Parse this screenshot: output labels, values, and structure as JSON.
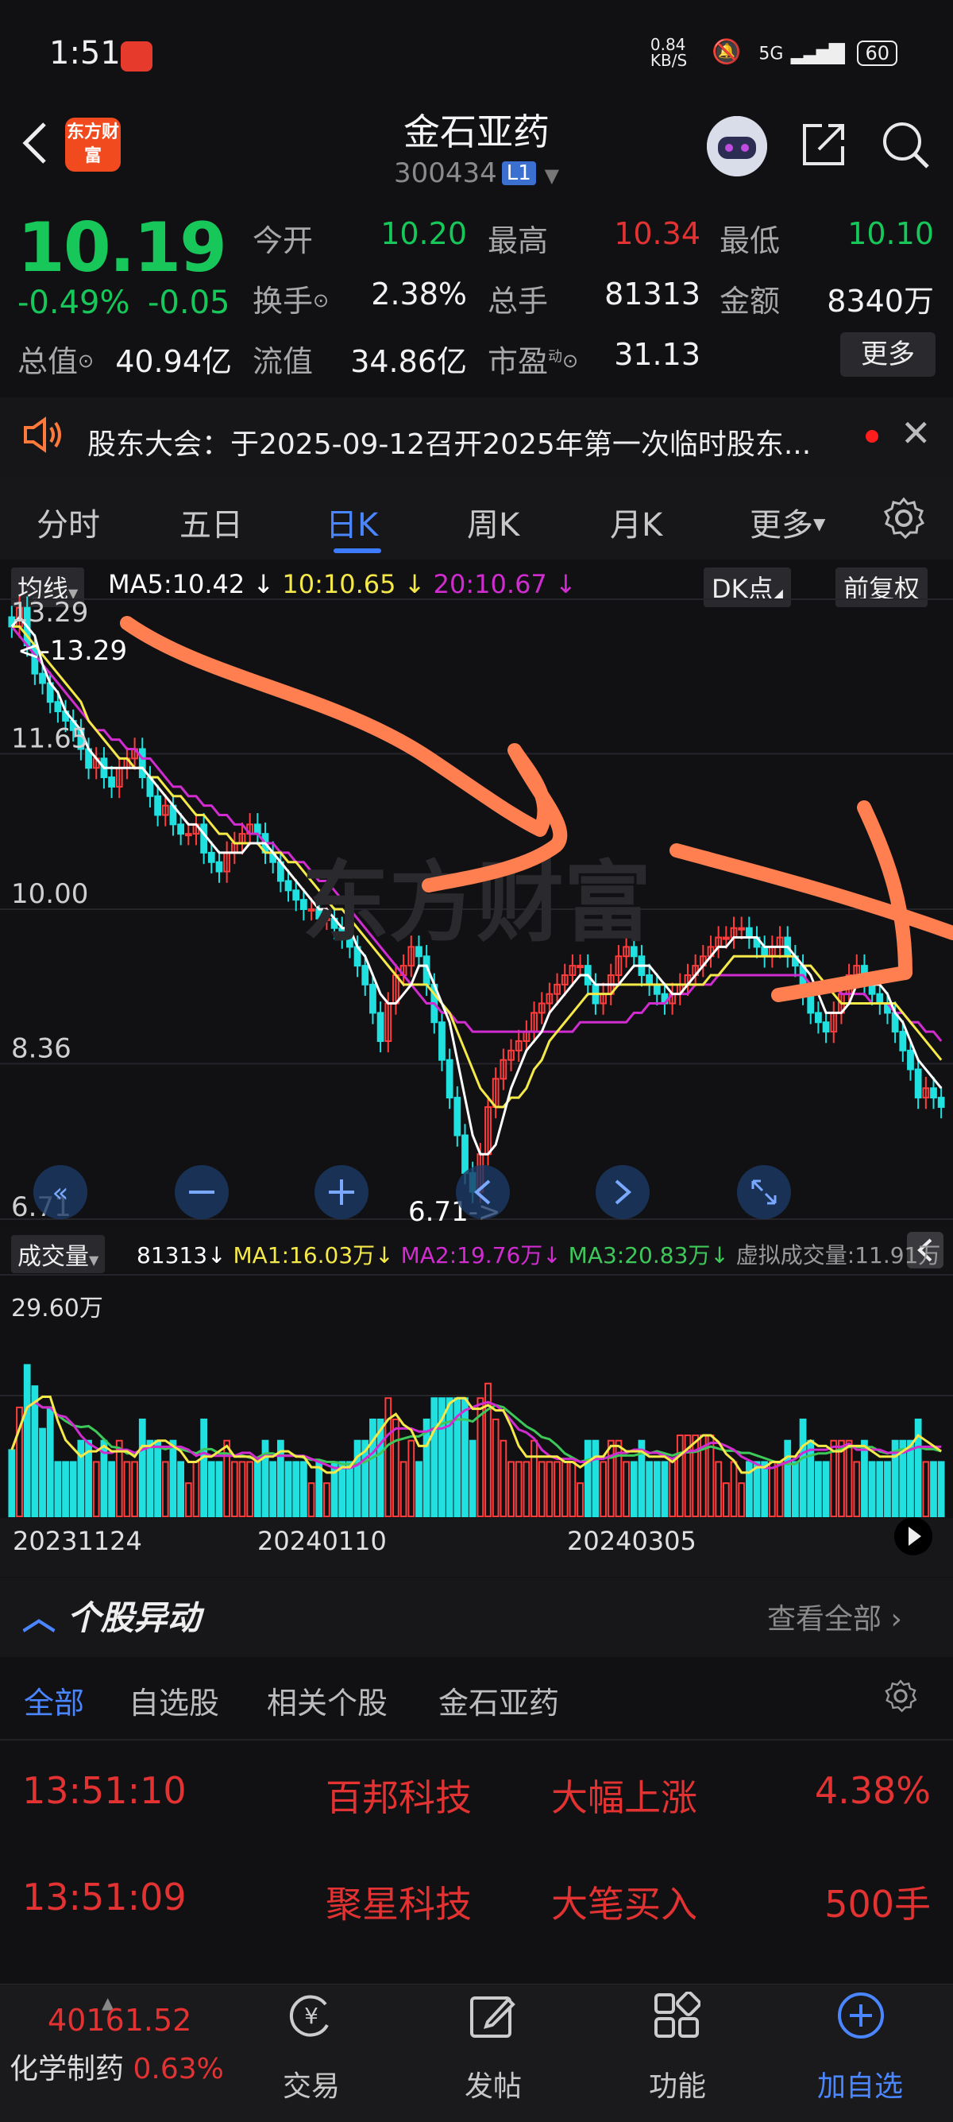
{
  "status_bar": {
    "time": "1:51",
    "net_speed": "0.84 KB/S",
    "network": "5G",
    "battery": "60"
  },
  "header": {
    "back_icon": "chevron-left-icon",
    "logo_text": "东方财富",
    "stock_name": "金石亚药",
    "stock_code": "300434",
    "level_badge": "L1",
    "share_icon": "share-icon",
    "search_icon": "search-icon"
  },
  "quote": {
    "price": "10.19",
    "change_pct": "-0.49%",
    "change_amt": "-0.05",
    "fields": [
      {
        "label": "今开",
        "value": "10.20",
        "color": "#17c75a"
      },
      {
        "label": "最高",
        "value": "10.34",
        "color": "#e23232"
      },
      {
        "label": "最低",
        "value": "10.10",
        "color": "#17c75a"
      },
      {
        "label": "换手",
        "value": "2.38%",
        "color": "#f2f2f2"
      },
      {
        "label": "总手",
        "value": "81313",
        "color": "#f2f2f2"
      },
      {
        "label": "金额",
        "value": "8340万",
        "color": "#f2f2f2"
      },
      {
        "label": "总值",
        "value": "40.94亿",
        "color": "#f2f2f2"
      },
      {
        "label": "流值",
        "value": "34.86亿",
        "color": "#f2f2f2"
      },
      {
        "label": "市盈",
        "value": "31.13",
        "color": "#f2f2f2"
      }
    ],
    "pe_superscript": "动",
    "more_label": "更多"
  },
  "notice": {
    "text": "股东大会：于2025-09-12召开2025年第一次临时股东..."
  },
  "tabs": [
    "分时",
    "五日",
    "日K",
    "周K",
    "月K",
    "更多"
  ],
  "active_tab": "日K",
  "chart_legend": {
    "ma_dropdown": "均线",
    "ma5": "MA5:10.42",
    "ma10": "10:10.65",
    "ma20": "20:10.67",
    "dk_button": "DK点",
    "adjust_button": "前复权",
    "ma5_color": "#ffffff",
    "ma10_color": "#f5e94a",
    "ma20_color": "#d02cd0"
  },
  "volume_legend": {
    "dropdown": "成交量",
    "volume": "81313",
    "ma1": "MA1:16.03万",
    "ma2": "MA2:19.76万",
    "ma3": "MA3:20.83万",
    "virtual": "虚拟成交量:11.91万",
    "ma1_color": "#f5e94a",
    "ma2_color": "#d02cd0",
    "ma3_color": "#3fc85a"
  },
  "chart_data": {
    "type": "candlestick",
    "y_tick_labels": [
      "13.29",
      "11.65",
      "10.00",
      "8.36",
      "6.71"
    ],
    "ylim": [
      6.71,
      13.29
    ],
    "max_label": "<-13.29",
    "min_label": "6.71->",
    "x_tick_labels": [
      "20231124",
      "20240110",
      "20240305"
    ],
    "volume_max_label": "29.60万",
    "close": [
      13.0,
      13.2,
      12.8,
      12.5,
      12.4,
      12.2,
      12.1,
      12.0,
      11.9,
      11.7,
      11.5,
      11.6,
      11.4,
      11.3,
      11.5,
      11.6,
      11.7,
      11.4,
      11.2,
      11.0,
      11.1,
      10.9,
      10.8,
      10.8,
      10.9,
      10.6,
      10.5,
      10.4,
      10.6,
      10.7,
      10.8,
      10.9,
      10.8,
      10.6,
      10.5,
      10.3,
      10.2,
      10.1,
      10.0,
      10.0,
      9.9,
      9.9,
      9.8,
      9.7,
      9.6,
      9.4,
      9.2,
      8.9,
      8.6,
      9.0,
      9.3,
      9.4,
      9.6,
      9.5,
      9.2,
      8.8,
      8.4,
      8.0,
      7.6,
      7.2,
      7.0,
      7.4,
      7.9,
      8.2,
      8.4,
      8.5,
      8.6,
      8.7,
      8.9,
      9.0,
      9.1,
      9.2,
      9.3,
      9.4,
      9.4,
      9.2,
      9.0,
      9.1,
      9.3,
      9.5,
      9.6,
      9.5,
      9.3,
      9.2,
      9.1,
      9.0,
      9.1,
      9.2,
      9.3,
      9.4,
      9.5,
      9.6,
      9.7,
      9.7,
      9.8,
      9.8,
      9.7,
      9.6,
      9.5,
      9.6,
      9.7,
      9.5,
      9.4,
      9.1,
      8.9,
      8.8,
      8.7,
      8.9,
      9.1,
      9.3,
      9.4,
      9.2,
      9.1,
      9.0,
      8.9,
      8.7,
      8.5,
      8.3,
      8.0,
      8.1,
      8.0,
      7.9
    ],
    "ma5": [
      13.0,
      13.1,
      13.0,
      12.9,
      12.6,
      12.4,
      12.3,
      12.1,
      12.0,
      11.9,
      11.7,
      11.6,
      11.5,
      11.5,
      11.5,
      11.5,
      11.5,
      11.5,
      11.4,
      11.3,
      11.2,
      11.1,
      11.0,
      10.9,
      10.9,
      10.8,
      10.7,
      10.6,
      10.6,
      10.6,
      10.6,
      10.7,
      10.7,
      10.7,
      10.6,
      10.5,
      10.4,
      10.3,
      10.2,
      10.1,
      10.0,
      10.0,
      9.9,
      9.8,
      9.8,
      9.6,
      9.5,
      9.3,
      9.1,
      9.0,
      9.0,
      9.1,
      9.2,
      9.4,
      9.4,
      9.2,
      9.0,
      8.8,
      8.4,
      8.0,
      7.6,
      7.4,
      7.4,
      7.5,
      7.8,
      8.1,
      8.3,
      8.5,
      8.6,
      8.7,
      8.9,
      9.0,
      9.1,
      9.2,
      9.3,
      9.3,
      9.2,
      9.2,
      9.2,
      9.2,
      9.3,
      9.4,
      9.4,
      9.4,
      9.3,
      9.2,
      9.1,
      9.1,
      9.2,
      9.3,
      9.4,
      9.5,
      9.6,
      9.6,
      9.7,
      9.7,
      9.7,
      9.7,
      9.6,
      9.6,
      9.6,
      9.6,
      9.5,
      9.4,
      9.3,
      9.1,
      8.9,
      8.9,
      8.9,
      9.0,
      9.2,
      9.2,
      9.2,
      9.2,
      9.1,
      8.9,
      8.8,
      8.6,
      8.4,
      8.3,
      8.2,
      8.1
    ],
    "ma10": [
      13.0,
      13.0,
      12.9,
      12.8,
      12.7,
      12.6,
      12.5,
      12.4,
      12.3,
      12.2,
      12.0,
      11.9,
      11.8,
      11.7,
      11.6,
      11.6,
      11.5,
      11.5,
      11.4,
      11.4,
      11.3,
      11.2,
      11.2,
      11.1,
      11.0,
      11.0,
      10.9,
      10.8,
      10.8,
      10.7,
      10.7,
      10.7,
      10.7,
      10.6,
      10.6,
      10.6,
      10.5,
      10.5,
      10.4,
      10.3,
      10.2,
      10.1,
      10.0,
      10.0,
      9.9,
      9.8,
      9.7,
      9.6,
      9.5,
      9.4,
      9.3,
      9.2,
      9.2,
      9.2,
      9.2,
      9.1,
      9.0,
      8.9,
      8.7,
      8.5,
      8.3,
      8.1,
      8.0,
      7.9,
      7.9,
      8.0,
      8.0,
      8.1,
      8.3,
      8.4,
      8.6,
      8.7,
      8.8,
      8.9,
      9.0,
      9.1,
      9.1,
      9.1,
      9.1,
      9.2,
      9.2,
      9.2,
      9.2,
      9.2,
      9.2,
      9.2,
      9.2,
      9.2,
      9.2,
      9.2,
      9.2,
      9.3,
      9.3,
      9.4,
      9.5,
      9.5,
      9.5,
      9.5,
      9.5,
      9.5,
      9.5,
      9.5,
      9.5,
      9.4,
      9.4,
      9.3,
      9.2,
      9.1,
      9.0,
      9.0,
      9.0,
      9.0,
      9.0,
      9.0,
      9.0,
      9.0,
      8.9,
      8.8,
      8.7,
      8.6,
      8.5,
      8.4
    ],
    "ma20": [
      13.0,
      12.9,
      12.8,
      12.7,
      12.6,
      12.5,
      12.4,
      12.3,
      12.2,
      12.1,
      12.0,
      11.9,
      11.9,
      11.8,
      11.8,
      11.7,
      11.7,
      11.6,
      11.6,
      11.5,
      11.4,
      11.3,
      11.3,
      11.2,
      11.2,
      11.1,
      11.1,
      11.0,
      11.0,
      10.9,
      10.9,
      10.8,
      10.8,
      10.7,
      10.7,
      10.6,
      10.6,
      10.5,
      10.5,
      10.4,
      10.3,
      10.3,
      10.2,
      10.1,
      10.0,
      9.9,
      9.8,
      9.7,
      9.6,
      9.5,
      9.4,
      9.3,
      9.2,
      9.1,
      9.0,
      9.0,
      8.9,
      8.9,
      8.8,
      8.8,
      8.7,
      8.7,
      8.7,
      8.7,
      8.7,
      8.7,
      8.7,
      8.7,
      8.7,
      8.7,
      8.7,
      8.7,
      8.7,
      8.7,
      8.8,
      8.8,
      8.8,
      8.8,
      8.8,
      8.8,
      8.8,
      8.9,
      8.9,
      9.0,
      9.0,
      9.0,
      9.1,
      9.1,
      9.1,
      9.2,
      9.2,
      9.2,
      9.3,
      9.3,
      9.3,
      9.3,
      9.3,
      9.3,
      9.3,
      9.3,
      9.3,
      9.3,
      9.3,
      9.3,
      9.2,
      9.2,
      9.2,
      9.2,
      9.1,
      9.1,
      9.1,
      9.1,
      9.0,
      9.0,
      9.0,
      8.9,
      8.9,
      8.8,
      8.8,
      8.7,
      8.7,
      8.6
    ]
  },
  "section": {
    "title": "个股异动",
    "view_all": "查看全部",
    "subtabs": [
      "全部",
      "自选股",
      "相关个股",
      "金石亚药"
    ],
    "rows": [
      {
        "time": "13:51:10",
        "name": "百邦科技",
        "event": "大幅上涨",
        "value": "4.38%"
      },
      {
        "time": "13:51:09",
        "name": "聚星科技",
        "event": "大笔买入",
        "value": "500手"
      }
    ]
  },
  "bottom_nav": {
    "index_value": "40161.52",
    "index_name": "化学制药",
    "index_change": "0.63%",
    "items": [
      "交易",
      "发帖",
      "功能",
      "加自选"
    ]
  }
}
